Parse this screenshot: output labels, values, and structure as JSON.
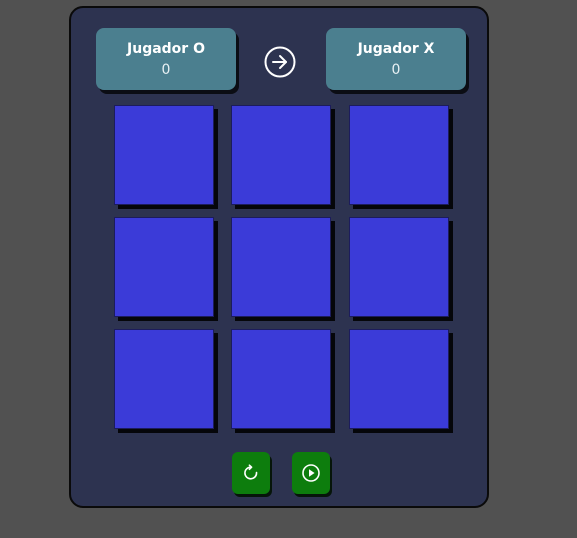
{
  "players": [
    {
      "name": "Jugador O",
      "score": "0"
    },
    {
      "name": "Jugador X",
      "score": "0"
    }
  ],
  "turn_indicator": {
    "icon": "arrow-right-circle-icon"
  },
  "board": {
    "cells": [
      "",
      "",
      "",
      "",
      "",
      "",
      "",
      "",
      ""
    ]
  },
  "controls": {
    "restart_icon": "restart-icon",
    "play_icon": "play-icon"
  },
  "colors": {
    "background": "#515151",
    "panel": "#2d3350",
    "score_card": "#4b7f8f",
    "cell": "#3b3bd8",
    "control_button": "#0d7d0d"
  }
}
